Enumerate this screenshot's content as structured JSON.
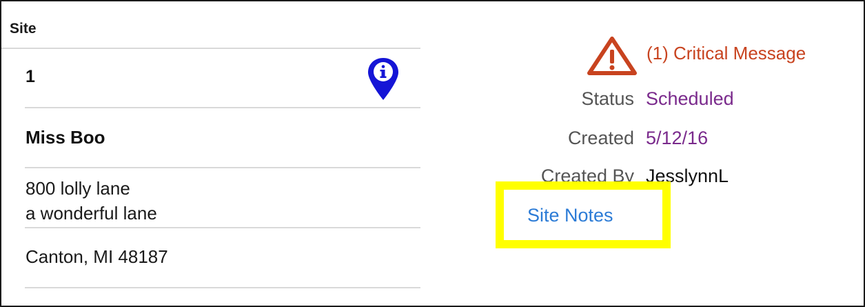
{
  "site": {
    "header": "Site",
    "number": "1",
    "name": "Miss Boo",
    "address_line1": "800 lolly lane",
    "address_line2": "a wonderful lane",
    "city_line": "Canton, MI 48187",
    "info_icon": "map-pin-info-icon"
  },
  "details": {
    "critical_message": "(1) Critical Message",
    "warning_icon": "warning-triangle-icon",
    "status_label": "Status",
    "status_value": "Scheduled",
    "created_label": "Created",
    "created_value": "5/12/16",
    "created_by_label": "Created By",
    "created_by_value": "JesslynnL",
    "site_notes_link": "Site Notes"
  },
  "colors": {
    "critical": "#c8431f",
    "value_purple": "#7a2a8c",
    "link_blue": "#2b7bd6",
    "pin_blue": "#1515d6",
    "highlight": "#ffff00"
  }
}
